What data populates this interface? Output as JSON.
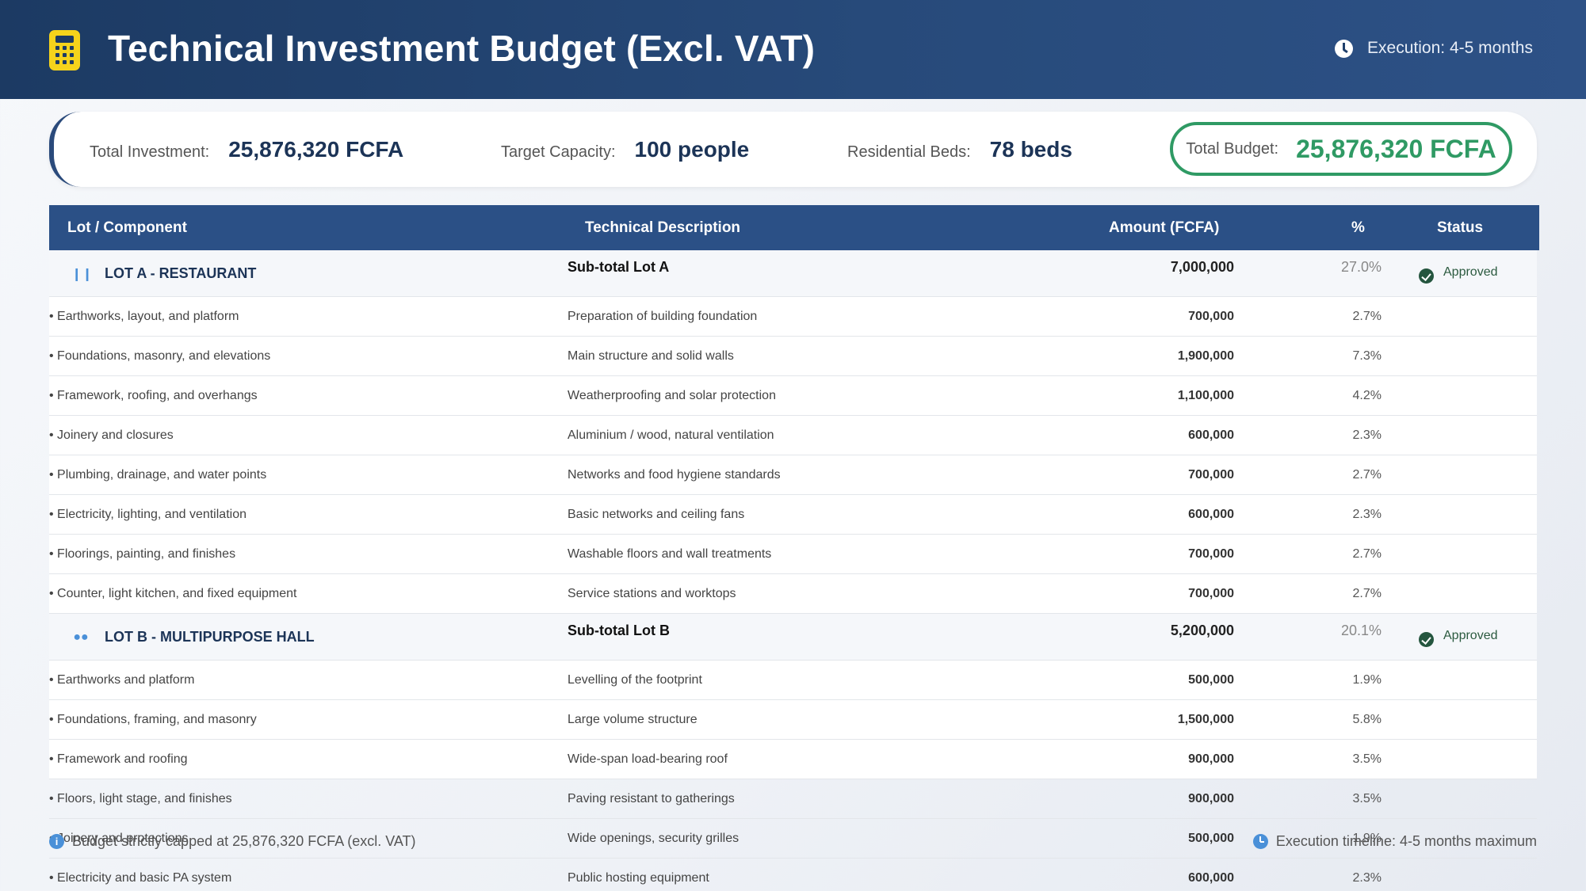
{
  "header": {
    "title": "Technical Investment Budget (Excl. VAT)",
    "execution": "Execution: 4-5 months",
    "logo_icon": "calculator-icon",
    "clock_icon": "clock-icon"
  },
  "summary": {
    "total_investment_label": "Total Investment:",
    "total_investment_value": "25,876,320 FCFA",
    "target_capacity_label": "Target Capacity:",
    "target_capacity_value": "100 people",
    "residential_beds_label": "Residential Beds:",
    "residential_beds_value": "78 beds",
    "total_budget_label": "Total Budget:",
    "total_budget_value": "25,876,320 FCFA"
  },
  "table": {
    "headers": [
      "Lot / Component",
      "Technical Description",
      "Amount (FCFA)",
      "%",
      "Status"
    ],
    "lot_a": {
      "name": "LOT A - RESTAURANT",
      "icon": "utensils-icon",
      "subtotal_label": "Sub-total Lot A",
      "amount": "7,000,000",
      "percent": "27.0%",
      "status": "Approved",
      "items": [
        {
          "component": "• Earthworks, layout, and platform",
          "description": "Preparation of building foundation",
          "amount": "700,000",
          "percent": "2.7%"
        },
        {
          "component": "• Foundations, masonry, and elevations",
          "description": "Main structure and solid walls",
          "amount": "1,900,000",
          "percent": "7.3%"
        },
        {
          "component": "• Framework, roofing, and overhangs",
          "description": "Weatherproofing and solar protection",
          "amount": "1,100,000",
          "percent": "4.2%"
        },
        {
          "component": "• Joinery and closures",
          "description": "Aluminium / wood, natural ventilation",
          "amount": "600,000",
          "percent": "2.3%"
        },
        {
          "component": "• Plumbing, drainage, and water points",
          "description": "Networks and food hygiene standards",
          "amount": "700,000",
          "percent": "2.7%"
        },
        {
          "component": "• Electricity, lighting, and ventilation",
          "description": "Basic networks and ceiling fans",
          "amount": "600,000",
          "percent": "2.3%"
        },
        {
          "component": "• Floorings, painting, and finishes",
          "description": "Washable floors and wall treatments",
          "amount": "700,000",
          "percent": "2.7%"
        },
        {
          "component": "• Counter, light kitchen, and fixed equipment",
          "description": "Service stations and worktops",
          "amount": "700,000",
          "percent": "2.7%"
        }
      ]
    },
    "lot_b": {
      "name": "LOT B - MULTIPURPOSE HALL",
      "icon": "users-icon",
      "subtotal_label": "Sub-total Lot B",
      "amount": "5,200,000",
      "percent": "20.1%",
      "status": "Approved",
      "items": [
        {
          "component": "• Earthworks and platform",
          "description": "Levelling of the footprint",
          "amount": "500,000",
          "percent": "1.9%"
        },
        {
          "component": "• Foundations, framing, and masonry",
          "description": "Large volume structure",
          "amount": "1,500,000",
          "percent": "5.8%"
        },
        {
          "component": "• Framework and roofing",
          "description": "Wide-span load-bearing roof",
          "amount": "900,000",
          "percent": "3.5%"
        },
        {
          "component": "• Floors, light stage, and finishes",
          "description": "Paving resistant to gatherings",
          "amount": "900,000",
          "percent": "3.5%"
        },
        {
          "component": "• Joinery and protections",
          "description": "Wide openings, security grilles",
          "amount": "500,000",
          "percent": "1.9%"
        },
        {
          "component": "• Electricity and basic PA system",
          "description": "Public hosting equipment",
          "amount": "600,000",
          "percent": "2.3%"
        }
      ]
    }
  },
  "footer": {
    "left_note": "Budget strictly capped at 25,876,320 FCFA (excl. VAT)",
    "right_note": "Execution timeline: 4-5 months maximum"
  }
}
